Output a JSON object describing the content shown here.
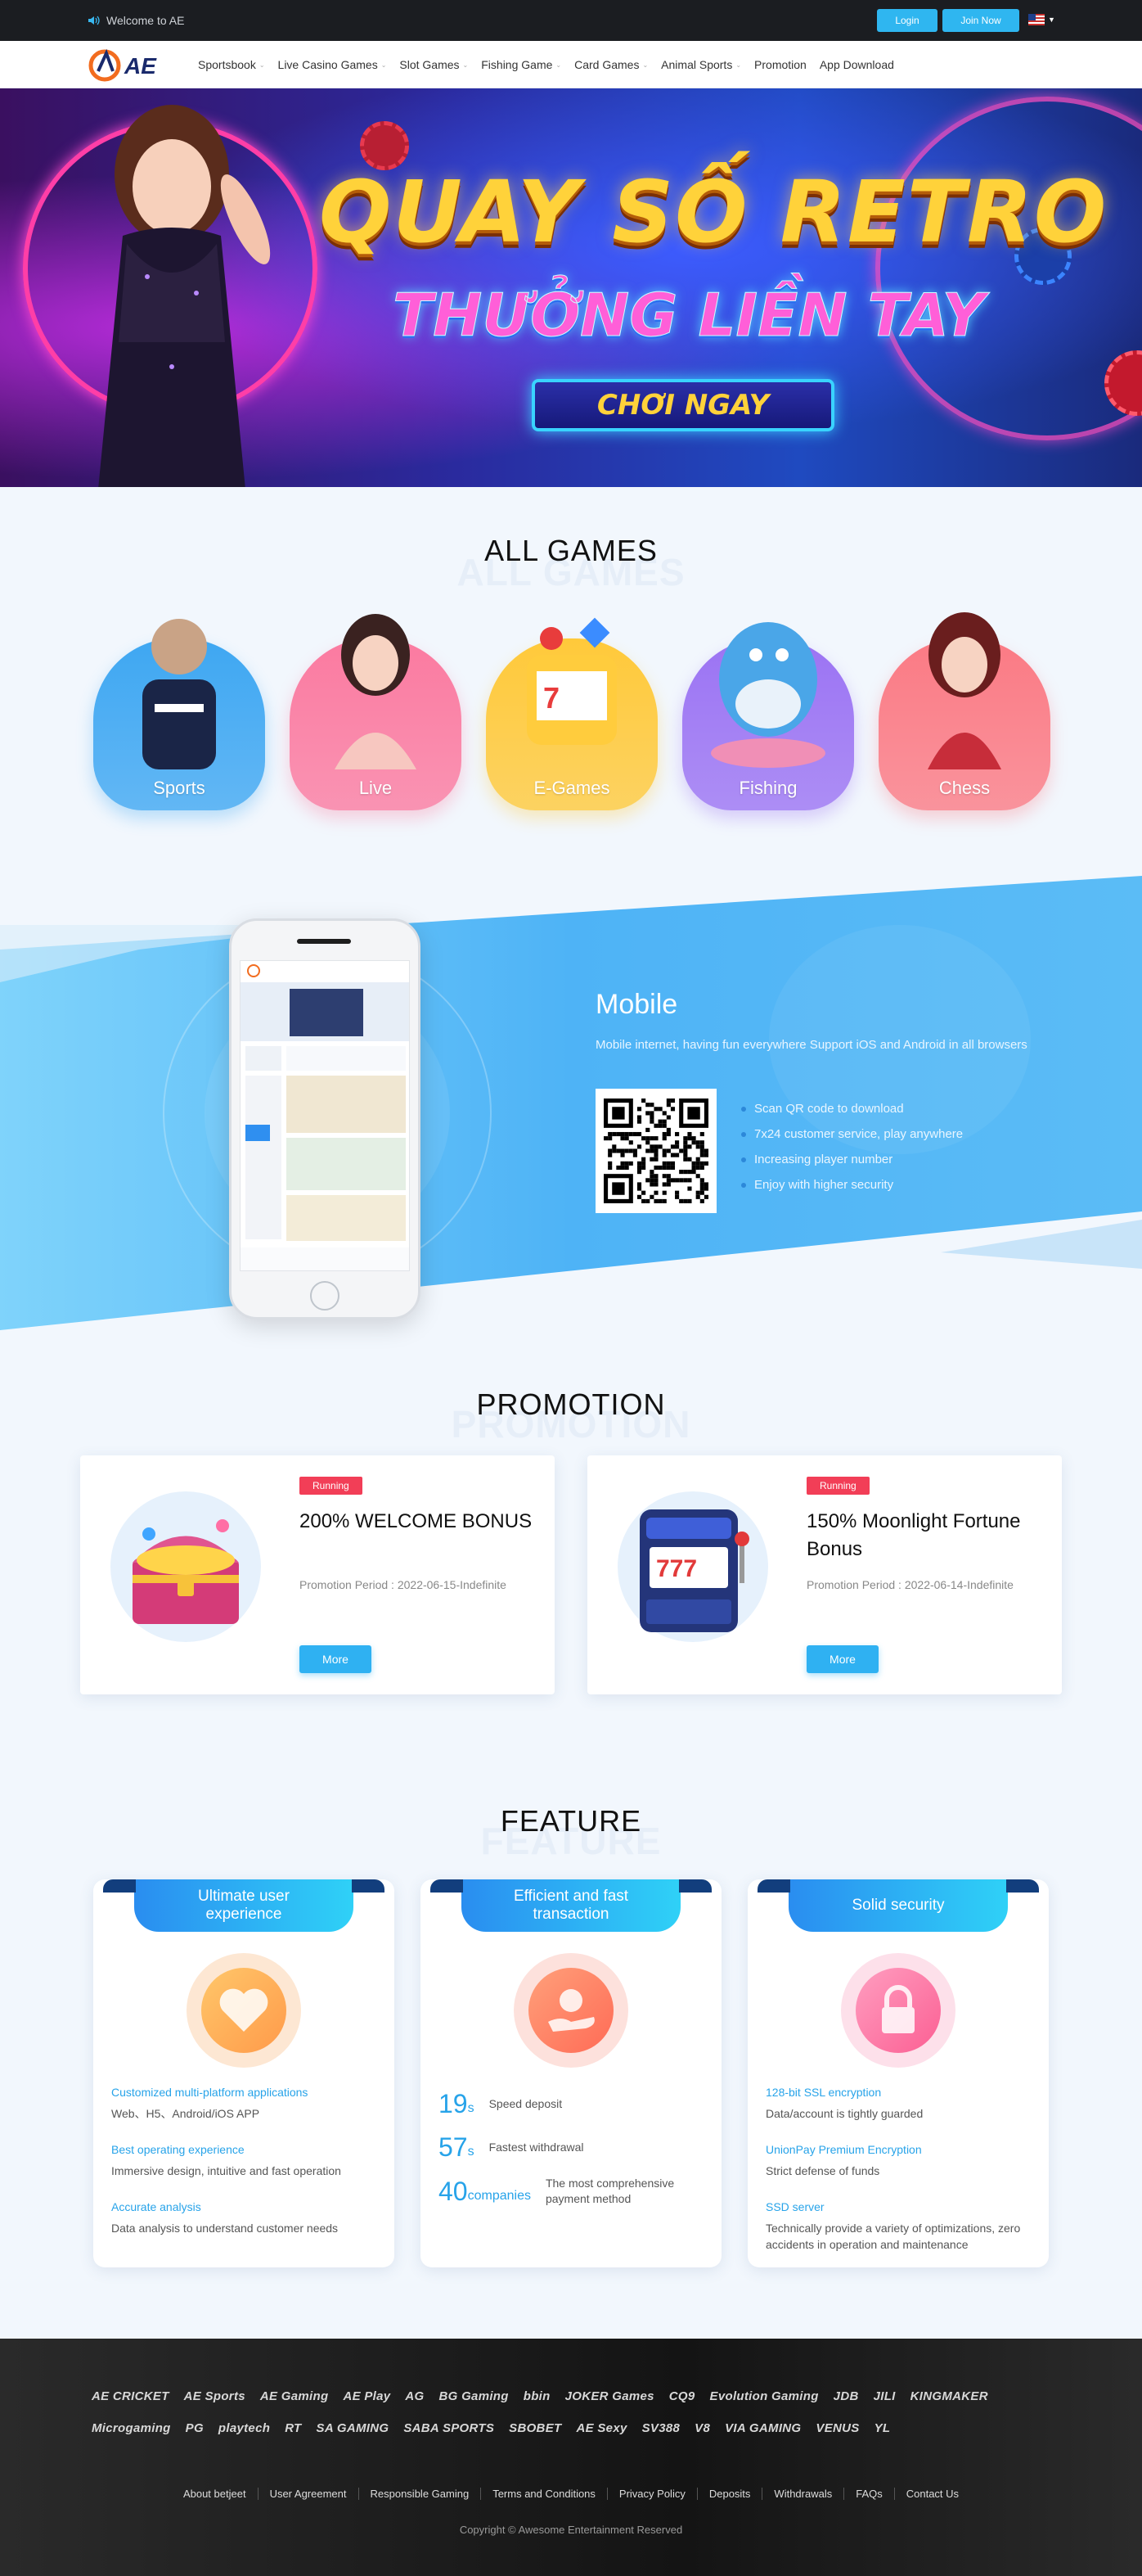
{
  "topbar": {
    "welcome": "Welcome to AE",
    "login": "Login",
    "join": "Join Now"
  },
  "nav": {
    "logo_text": "AE",
    "items": [
      {
        "label": "Sportsbook",
        "dropdown": true
      },
      {
        "label": "Live Casino Games",
        "dropdown": true
      },
      {
        "label": "Slot Games",
        "dropdown": true
      },
      {
        "label": "Fishing Game",
        "dropdown": true
      },
      {
        "label": "Card Games",
        "dropdown": true
      },
      {
        "label": "Animal Sports",
        "dropdown": true
      },
      {
        "label": "Promotion",
        "dropdown": false
      },
      {
        "label": "App Download",
        "dropdown": false
      }
    ]
  },
  "banner": {
    "line1": "QUAY SỐ RETRO",
    "line2": "THƯỞNG LIỀN TAY",
    "cta": "CHƠI NGAY"
  },
  "all_games": {
    "title": "ALL GAMES",
    "ghost": "ALL GAMES",
    "items": [
      {
        "label": "Sports",
        "color": "#3ea7f2"
      },
      {
        "label": "Live",
        "color": "#fb7aa0"
      },
      {
        "label": "E-Games",
        "color": "#ffc93a"
      },
      {
        "label": "Fishing",
        "color": "#9b73f3"
      },
      {
        "label": "Chess",
        "color": "#fb7a84"
      }
    ]
  },
  "mobile": {
    "title": "Mobile",
    "desc": "Mobile internet, having fun everywhere Support iOS and Android in all browsers",
    "list": [
      "Scan QR code to download",
      "7x24 customer service, play anywhere",
      "Increasing player number",
      "Enjoy with higher security"
    ]
  },
  "promotion": {
    "title": "PROMOTION",
    "ghost": "PROMOTION",
    "cards": [
      {
        "badge": "Running",
        "title": "200% WELCOME BONUS",
        "period": "Promotion Period : 2022-06-15-Indefinite",
        "more": "More"
      },
      {
        "badge": "Running",
        "title": "150% Moonlight Fortune Bonus",
        "period": "Promotion Period : 2022-06-14-Indefinite",
        "more": "More"
      }
    ]
  },
  "feature": {
    "title": "FEATURE",
    "ghost": "FEATURE",
    "cards": [
      {
        "ribbon": "Ultimate user experience",
        "rows": [
          {
            "h": "Customized multi-platform applications",
            "p": "Web、H5、Android/iOS APP"
          },
          {
            "h": "Best operating experience",
            "p": "Immersive design, intuitive and fast operation"
          },
          {
            "h": "Accurate analysis",
            "p": "Data analysis to understand customer needs"
          }
        ]
      },
      {
        "ribbon": "Efficient and fast transaction",
        "stats": [
          {
            "num": "19",
            "unit": "s",
            "desc": "Speed deposit"
          },
          {
            "num": "57",
            "unit": "s",
            "desc": "Fastest withdrawal"
          },
          {
            "num": "40",
            "unit": "companies",
            "desc": "The most comprehensive payment method"
          }
        ]
      },
      {
        "ribbon": "Solid security",
        "rows": [
          {
            "h": "128-bit SSL encryption",
            "p": "Data/account is tightly guarded"
          },
          {
            "h": "UnionPay Premium Encryption",
            "p": "Strict defense of funds"
          },
          {
            "h": "SSD server",
            "p": "Technically provide a variety of optimizations, zero accidents in operation and maintenance"
          }
        ]
      }
    ]
  },
  "footer": {
    "logos": [
      "AE CRICKET",
      "AE Sports",
      "AE Gaming",
      "AE Play",
      "AG",
      "BG Gaming",
      "bbin",
      "JOKER Games",
      "CQ9",
      "Evolution Gaming",
      "JDB",
      "JILI",
      "KINGMAKER",
      "Microgaming",
      "PG",
      "playtech",
      "RT",
      "SA GAMING",
      "SABA SPORTS",
      "SBOBET",
      "AE Sexy",
      "SV388",
      "V8",
      "VIA GAMING",
      "VENUS",
      "YL"
    ],
    "links": [
      "About betjeet",
      "User Agreement",
      "Responsible Gaming",
      "Terms and Conditions",
      "Privacy Policy",
      "Deposits",
      "Withdrawals",
      "FAQs",
      "Contact Us"
    ],
    "copyright": "Copyright © Awesome Entertainment Reserved"
  }
}
